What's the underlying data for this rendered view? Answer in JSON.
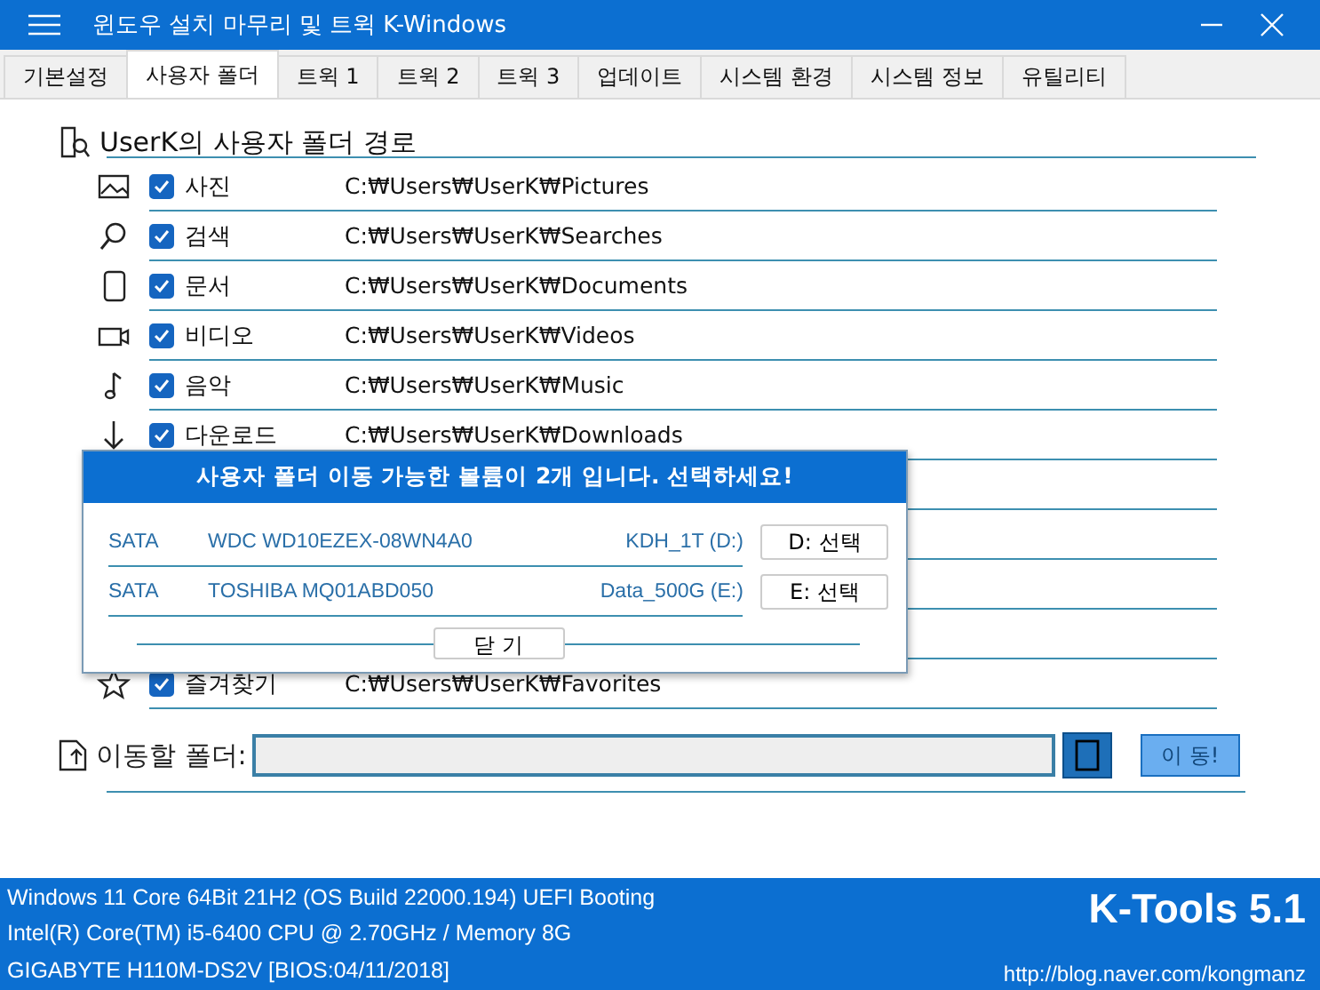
{
  "window": {
    "title": "윈도우 설치 마무리 및 트윅 K-Windows"
  },
  "tabs": [
    {
      "label": "기본설정",
      "selected": false
    },
    {
      "label": "사용자 폴더",
      "selected": true
    },
    {
      "label": "트윅 1",
      "selected": false
    },
    {
      "label": "트윅 2",
      "selected": false
    },
    {
      "label": "트윅 3",
      "selected": false
    },
    {
      "label": "업데이트",
      "selected": false
    },
    {
      "label": "시스템 환경",
      "selected": false
    },
    {
      "label": "시스템 정보",
      "selected": false
    },
    {
      "label": "유틸리티",
      "selected": false
    }
  ],
  "section": {
    "title": "UserK의 사용자 폴더 경로"
  },
  "folders": [
    {
      "name": "사진",
      "checked": true,
      "path": "C:₩Users₩UserK₩Pictures"
    },
    {
      "name": "검색",
      "checked": true,
      "path": "C:₩Users₩UserK₩Searches"
    },
    {
      "name": "문서",
      "checked": true,
      "path": "C:₩Users₩UserK₩Documents"
    },
    {
      "name": "비디오",
      "checked": true,
      "path": "C:₩Users₩UserK₩Videos"
    },
    {
      "name": "음악",
      "checked": true,
      "path": "C:₩Users₩UserK₩Music"
    },
    {
      "name": "다운로드",
      "checked": true,
      "path": "C:₩Users₩UserK₩Downloads"
    }
  ],
  "folders_after": [
    {
      "name": "즐겨찾기",
      "checked": true,
      "path": "C:₩Users₩UserK₩Favorites"
    }
  ],
  "target": {
    "label": "이동할 폴더:",
    "move_button": {
      "label": "이 동!",
      "disabled": true
    }
  },
  "dialog": {
    "title": "사용자 폴더 이동 가능한 볼륨이 2개 입니다. 선택하세요!",
    "volumes": [
      {
        "bus": "SATA",
        "model": "WDC WD10EZEX-08WN4A0",
        "volume": "KDH_1T (D:)",
        "button": "D: 선택"
      },
      {
        "bus": "SATA",
        "model": "TOSHIBA MQ01ABD050",
        "volume": "Data_500G (E:)",
        "button": "E: 선택"
      }
    ],
    "close": "닫 기"
  },
  "status_bar": {
    "lines": [
      "Windows 11 Core 64Bit 21H2  (OS Build 22000.194)  UEFI Booting",
      "Intel(R) Core(TM) i5-6400 CPU @ 2.70GHz / Memory 8G",
      "GIGABYTE H110M-DS2V [BIOS:04/11/2018]"
    ],
    "product": "K-Tools 5.1",
    "link": "http://blog.naver.com/kongmanz"
  }
}
